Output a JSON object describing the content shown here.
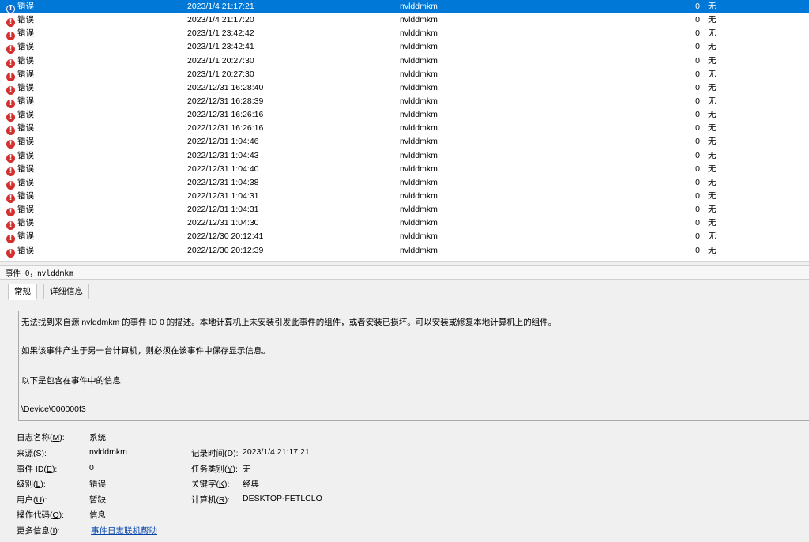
{
  "event_list": {
    "rows": [
      {
        "level": "错误",
        "date": "2023/1/4 21:17:21",
        "source": "nvlddmkm",
        "event_id": "0",
        "task_category": "无",
        "selected": true
      },
      {
        "level": "错误",
        "date": "2023/1/4 21:17:20",
        "source": "nvlddmkm",
        "event_id": "0",
        "task_category": "无"
      },
      {
        "level": "错误",
        "date": "2023/1/1 23:42:42",
        "source": "nvlddmkm",
        "event_id": "0",
        "task_category": "无"
      },
      {
        "level": "错误",
        "date": "2023/1/1 23:42:41",
        "source": "nvlddmkm",
        "event_id": "0",
        "task_category": "无"
      },
      {
        "level": "错误",
        "date": "2023/1/1 20:27:30",
        "source": "nvlddmkm",
        "event_id": "0",
        "task_category": "无"
      },
      {
        "level": "错误",
        "date": "2023/1/1 20:27:30",
        "source": "nvlddmkm",
        "event_id": "0",
        "task_category": "无"
      },
      {
        "level": "错误",
        "date": "2022/12/31 16:28:40",
        "source": "nvlddmkm",
        "event_id": "0",
        "task_category": "无"
      },
      {
        "level": "错误",
        "date": "2022/12/31 16:28:39",
        "source": "nvlddmkm",
        "event_id": "0",
        "task_category": "无"
      },
      {
        "level": "错误",
        "date": "2022/12/31 16:26:16",
        "source": "nvlddmkm",
        "event_id": "0",
        "task_category": "无"
      },
      {
        "level": "错误",
        "date": "2022/12/31 16:26:16",
        "source": "nvlddmkm",
        "event_id": "0",
        "task_category": "无"
      },
      {
        "level": "错误",
        "date": "2022/12/31 1:04:46",
        "source": "nvlddmkm",
        "event_id": "0",
        "task_category": "无"
      },
      {
        "level": "错误",
        "date": "2022/12/31 1:04:43",
        "source": "nvlddmkm",
        "event_id": "0",
        "task_category": "无"
      },
      {
        "level": "错误",
        "date": "2022/12/31 1:04:40",
        "source": "nvlddmkm",
        "event_id": "0",
        "task_category": "无"
      },
      {
        "level": "错误",
        "date": "2022/12/31 1:04:38",
        "source": "nvlddmkm",
        "event_id": "0",
        "task_category": "无"
      },
      {
        "level": "错误",
        "date": "2022/12/31 1:04:31",
        "source": "nvlddmkm",
        "event_id": "0",
        "task_category": "无"
      },
      {
        "level": "错误",
        "date": "2022/12/31 1:04:31",
        "source": "nvlddmkm",
        "event_id": "0",
        "task_category": "无"
      },
      {
        "level": "错误",
        "date": "2022/12/31 1:04:30",
        "source": "nvlddmkm",
        "event_id": "0",
        "task_category": "无"
      },
      {
        "level": "错误",
        "date": "2022/12/30 20:12:41",
        "source": "nvlddmkm",
        "event_id": "0",
        "task_category": "无"
      },
      {
        "level": "错误",
        "date": "2022/12/30 20:12:39",
        "source": "nvlddmkm",
        "event_id": "0",
        "task_category": "无"
      }
    ],
    "row_icon": "error-icon",
    "selection_color": "#0078d7"
  },
  "detail": {
    "header_title": "事件 0，nvlddmkm",
    "tabs": {
      "general": "常规",
      "details": "详细信息"
    },
    "description": {
      "line1": "无法找到来自源 nvlddmkm 的事件 ID 0 的描述。本地计算机上未安装引发此事件的组件，或者安装已损坏。可以安装或修复本地计算机上的组件。",
      "line2": "如果该事件产生于另一台计算机，则必须在该事件中保存显示信息。",
      "line3": "以下是包含在事件中的信息:",
      "line4": "\\Device\\000000f3"
    },
    "properties": {
      "log_name": {
        "label_pre": "日志名称(",
        "key": "M",
        "label_post": "):",
        "value": "系统"
      },
      "source": {
        "label_pre": "来源(",
        "key": "S",
        "label_post": "):",
        "value": "nvlddmkm"
      },
      "logged": {
        "label_pre": "记录时间(",
        "key": "D",
        "label_post": "):",
        "value": "2023/1/4 21:17:21"
      },
      "event_id": {
        "label_pre": "事件 ID(",
        "key": "E",
        "label_post": "):",
        "value": "0"
      },
      "task_cat": {
        "label_pre": "任务类别(",
        "key": "Y",
        "label_post": "):",
        "value": "无"
      },
      "level": {
        "label_pre": "级别(",
        "key": "L",
        "label_post": "):",
        "value": "错误"
      },
      "keywords": {
        "label_pre": "关键字(",
        "key": "K",
        "label_post": "):",
        "value": "经典"
      },
      "user": {
        "label_pre": "用户(",
        "key": "U",
        "label_post": "):",
        "value": "暂缺"
      },
      "computer": {
        "label_pre": "计算机(",
        "key": "R",
        "label_post": "):",
        "value": "DESKTOP-FETLCLO"
      },
      "opcode": {
        "label_pre": "操作代码(",
        "key": "O",
        "label_post": "):",
        "value": "信息"
      },
      "more_info": {
        "label_pre": "更多信息(",
        "key": "I",
        "label_post": "):",
        "value": "事件日志联机帮助"
      }
    }
  }
}
